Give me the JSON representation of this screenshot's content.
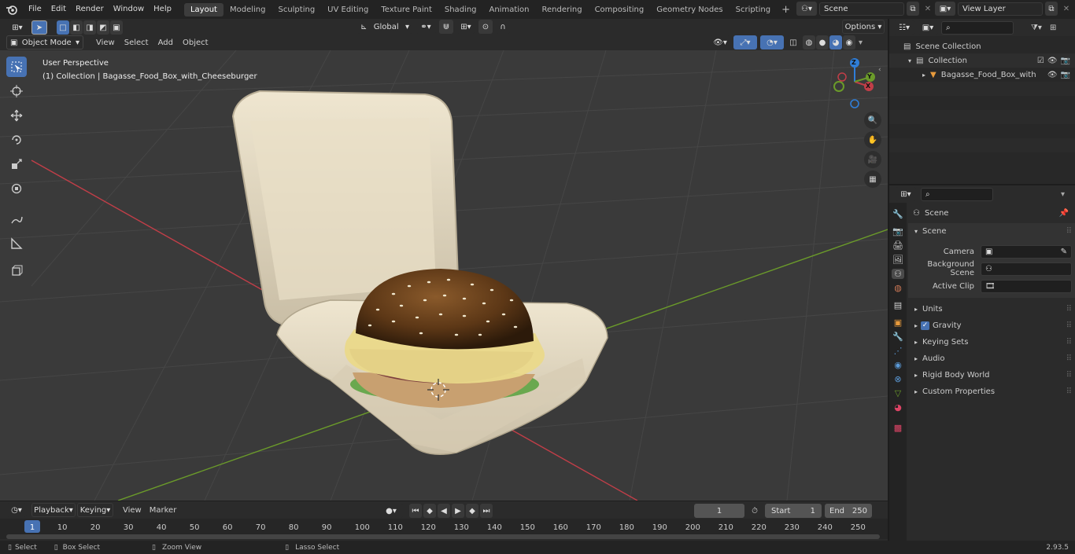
{
  "menu": [
    "File",
    "Edit",
    "Render",
    "Window",
    "Help"
  ],
  "workspaces": [
    {
      "label": "Layout",
      "active": true
    },
    {
      "label": "Modeling"
    },
    {
      "label": "Sculpting"
    },
    {
      "label": "UV Editing"
    },
    {
      "label": "Texture Paint"
    },
    {
      "label": "Shading"
    },
    {
      "label": "Animation"
    },
    {
      "label": "Rendering"
    },
    {
      "label": "Compositing"
    },
    {
      "label": "Geometry Nodes"
    },
    {
      "label": "Scripting"
    }
  ],
  "scene_field": "Scene",
  "view_layer_field": "View Layer",
  "header": {
    "mode": "Object Mode",
    "menus": [
      "View",
      "Select",
      "Add",
      "Object"
    ],
    "transform": "Global",
    "options": "Options"
  },
  "viewport": {
    "perspective": "User Perspective",
    "collection_line": "(1) Collection | Bagasse_Food_Box_with_Cheeseburger"
  },
  "gizmo": {
    "x": "X",
    "y": "Y",
    "z": "Z"
  },
  "outliner": {
    "scene_collection": "Scene Collection",
    "collection": "Collection",
    "object": "Bagasse_Food_Box_with"
  },
  "properties": {
    "context": "Scene",
    "panel": "Scene",
    "camera_label": "Camera",
    "background_label": "Background Scene",
    "clip_label": "Active Clip",
    "subpanels": [
      "Units",
      "Gravity",
      "Keying Sets",
      "Audio",
      "Rigid Body World",
      "Custom Properties"
    ]
  },
  "timeline": {
    "menus": [
      "Playback",
      "Keying",
      "View",
      "Marker"
    ],
    "current_frame": "1",
    "start_label": "Start",
    "start": "1",
    "end_label": "End",
    "end": "250",
    "ticks": [
      "1",
      "10",
      "20",
      "30",
      "40",
      "50",
      "60",
      "70",
      "80",
      "90",
      "100",
      "110",
      "120",
      "130",
      "140",
      "150",
      "160",
      "170",
      "180",
      "190",
      "200",
      "210",
      "220",
      "230",
      "240",
      "250"
    ]
  },
  "statusbar": {
    "select": "Select",
    "box_select": "Box Select",
    "zoom_view": "Zoom View",
    "lasso_select": "Lasso Select",
    "version": "2.93.5"
  },
  "colors": {
    "accent": "#4772b3",
    "x_axis": "#c13e48",
    "y_axis": "#6b9b2a",
    "z_axis": "#2f7ed8"
  }
}
